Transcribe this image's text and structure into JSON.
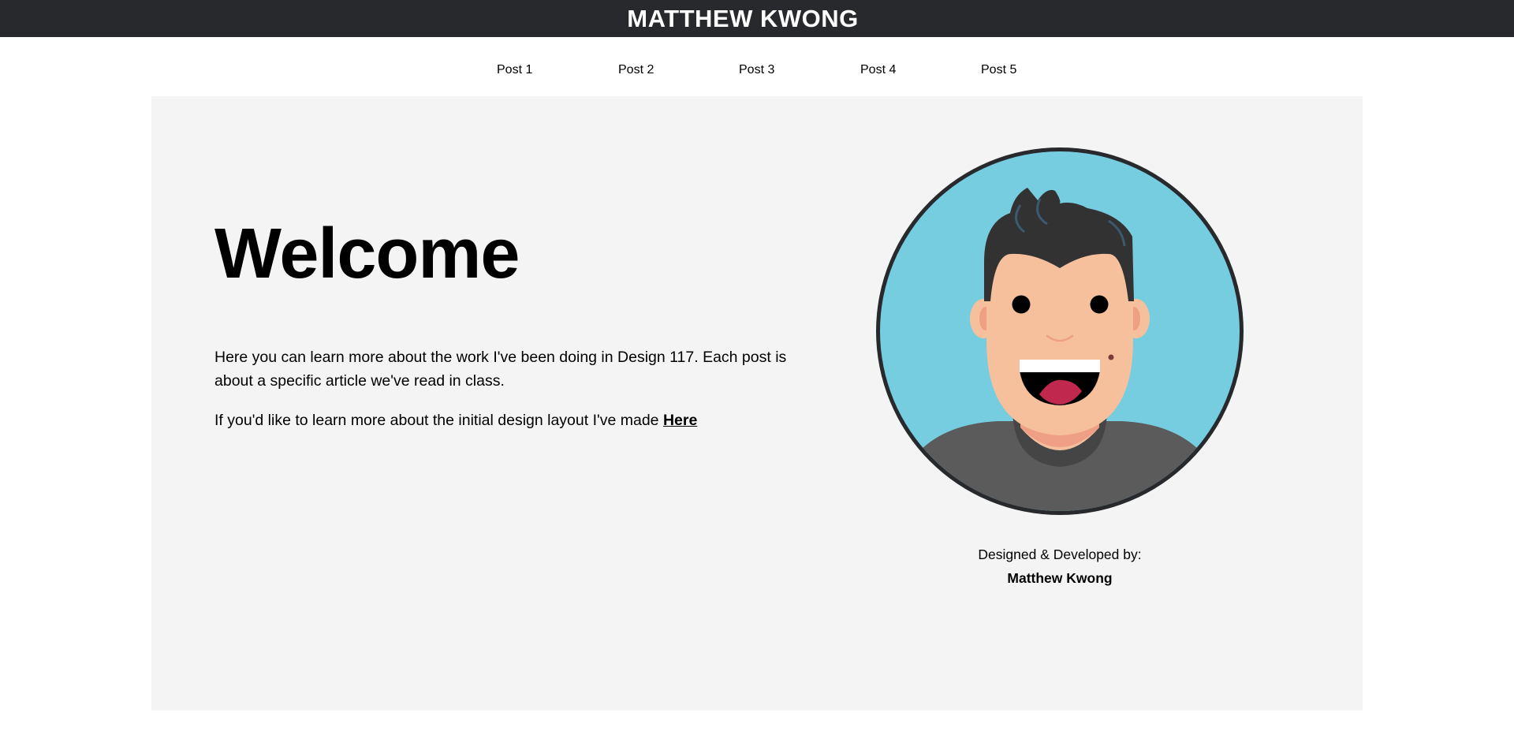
{
  "header": {
    "title": "MATTHEW KWONG"
  },
  "nav": {
    "items": [
      {
        "label": "Post 1"
      },
      {
        "label": "Post 2"
      },
      {
        "label": "Post 3"
      },
      {
        "label": "Post 4"
      },
      {
        "label": "Post 5"
      }
    ]
  },
  "main": {
    "heading": "Welcome",
    "intro": "Here you can learn more about the work I've been doing in Design 117. Each post is about a specific article we've read in class.",
    "layout_text": "If you'd like to learn more about the initial design layout I've made ",
    "layout_link": "Here"
  },
  "credit": {
    "label": "Designed & Developed by:",
    "name": "Matthew Kwong"
  },
  "colors": {
    "header_bg": "#27292c",
    "content_bg": "#f4f4f4",
    "avatar_bg": "#76cde0",
    "avatar_border": "#27292c"
  },
  "icons": {
    "avatar": "cartoon-man-avatar"
  }
}
